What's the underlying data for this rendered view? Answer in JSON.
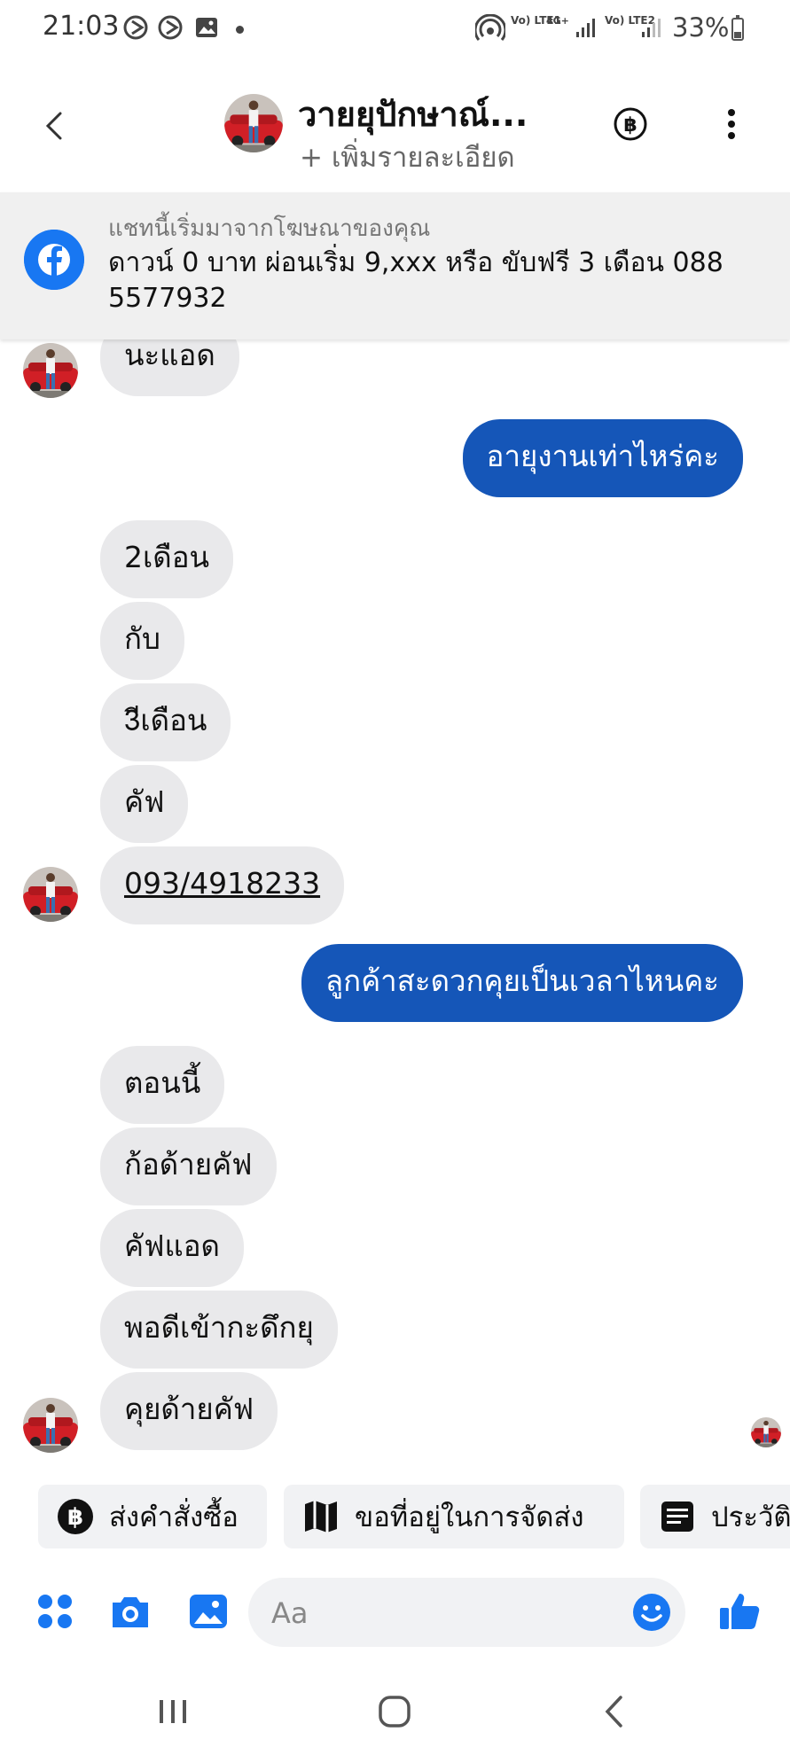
{
  "status_bar": {
    "time": "21:03",
    "sim1_label": "Vo) LTE1",
    "network_label": "4G+",
    "sim2_label": "Vo) LTE2",
    "battery_percent": "33%",
    "icons": [
      "media-play-icon",
      "media-play-icon",
      "image-icon",
      "notification-dot",
      "hotspot-icon",
      "signal-icon",
      "battery-icon"
    ]
  },
  "header": {
    "contact_name": "วายยุปักษาณ์...",
    "subtitle": "+ เพิ่มรายละเอียด",
    "back_icon": "back-arrow-icon",
    "payment_icon": "baht-icon",
    "menu_icon": "more-vertical-icon"
  },
  "ad_banner": {
    "caption": "แชทนี้เริ่มมาจากโฆษณาของคุณ",
    "text": "ดาวน์ 0 บาท ผ่อนเริ่ม 9,xxx หรือ ขับฟรี 3 เดือน  088 5577932",
    "icon": "facebook-icon"
  },
  "messages": [
    {
      "from": "contact",
      "text": "นะแอด"
    },
    {
      "from": "me",
      "text": "อายุงานเท่าไหร่คะ"
    },
    {
      "from": "contact",
      "text": "2เดือน"
    },
    {
      "from": "contact",
      "text": "กับ"
    },
    {
      "from": "contact",
      "text": "3ีเดือน"
    },
    {
      "from": "contact",
      "text": "คัฟ"
    },
    {
      "from": "contact",
      "text": "093/4918233"
    },
    {
      "from": "me",
      "text": "ลูกค้าสะดวกคุยเป็นเวลาไหนคะ"
    },
    {
      "from": "contact",
      "text": "ตอนนี้"
    },
    {
      "from": "contact",
      "text": "ก้อด้ายคัฟ"
    },
    {
      "from": "contact",
      "text": "คัฟแอด"
    },
    {
      "from": "contact",
      "text": "พอดีเข้ากะดึกยุ"
    },
    {
      "from": "contact",
      "text": "คุยด้ายคัฟ"
    }
  ],
  "quick_replies": [
    {
      "label": "ส่งคำสั่งซื้อ",
      "icon": "baht-icon"
    },
    {
      "label": "ขอที่อยู่ในการจัดส่ง",
      "icon": "map-icon"
    },
    {
      "label": "ประวัติ",
      "icon": "receipt-icon"
    }
  ],
  "composer": {
    "placeholder": "Aa",
    "icons": [
      "apps-icon",
      "camera-icon",
      "gallery-icon",
      "emoji-icon",
      "thumbs-up-icon"
    ]
  },
  "nav_bar": {
    "icons": [
      "recent-apps-icon",
      "home-icon",
      "nav-back-icon"
    ]
  },
  "colors": {
    "accent": "#1877f2",
    "outgoing_bubble": "#1556b8",
    "incoming_bubble": "#e9e9eb",
    "banner_bg": "#f0f0f0"
  }
}
